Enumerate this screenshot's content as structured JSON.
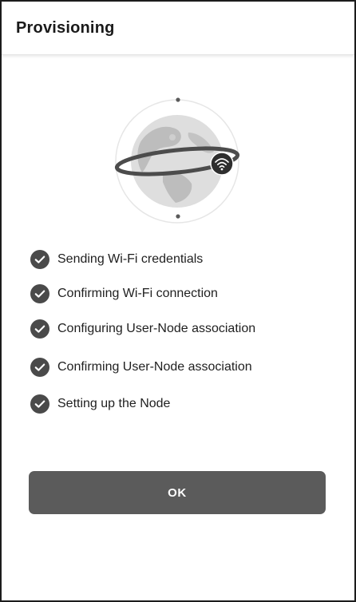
{
  "header": {
    "title": "Provisioning"
  },
  "illustration": {
    "icon": "globe-wifi-icon"
  },
  "steps": [
    {
      "label": "Sending Wi-Fi credentials",
      "status": "done",
      "icon": "check-circle-icon"
    },
    {
      "label": "Confirming Wi-Fi connection",
      "status": "done",
      "icon": "check-circle-icon"
    },
    {
      "label": "Configuring User-Node association",
      "status": "done",
      "icon": "check-circle-icon"
    },
    {
      "label": "Confirming User-Node association",
      "status": "done",
      "icon": "check-circle-icon"
    },
    {
      "label": "Setting up the Node",
      "status": "done",
      "icon": "check-circle-icon"
    }
  ],
  "actions": {
    "ok_label": "OK"
  },
  "colors": {
    "button": "#5b5b5b",
    "check": "#4a4a4a",
    "text": "#1f1f1f"
  }
}
